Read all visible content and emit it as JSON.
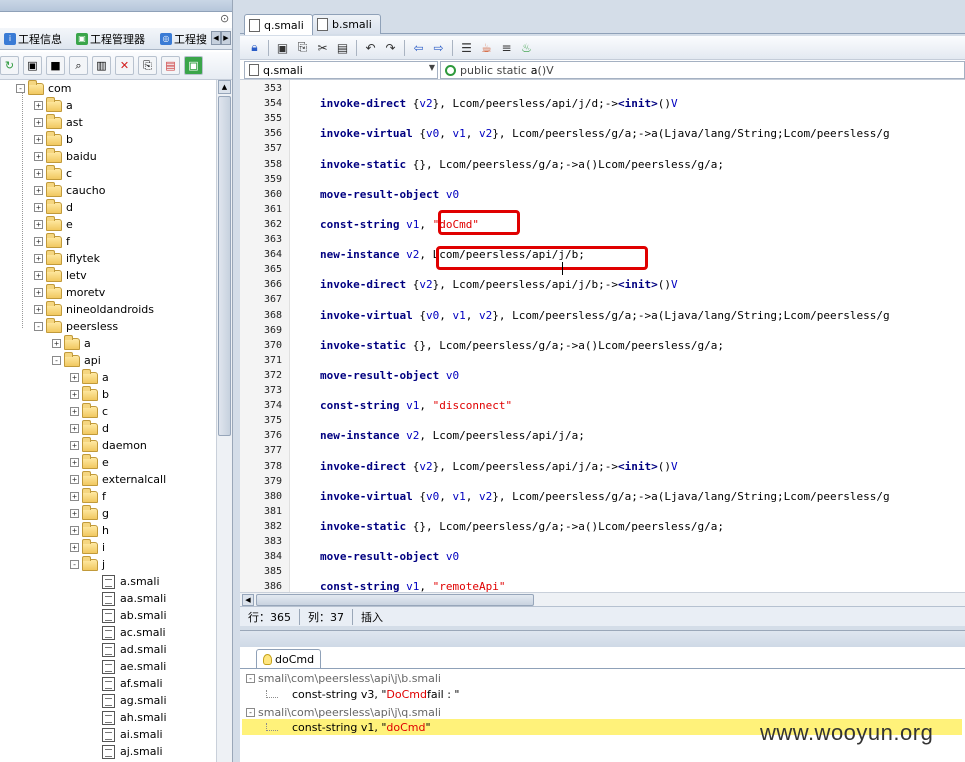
{
  "left_panel": {
    "tabs": [
      {
        "label": "工程信息",
        "icon_color": "#3a7bd5"
      },
      {
        "label": "工程管理器",
        "icon_color": "#3aa54a"
      },
      {
        "label": "工程搜",
        "icon_color": "#3a7bd5"
      }
    ],
    "toolbar_icons": [
      "refresh-icon",
      "screen-icon",
      "stop-icon",
      "find-icon",
      "book-icon",
      "delete-icon",
      "rename-icon",
      "pdf-icon",
      "android-icon"
    ],
    "tree": [
      {
        "label": "com",
        "indent": 0,
        "type": "folder",
        "expander": "-"
      },
      {
        "label": "a",
        "indent": 1,
        "type": "folder",
        "expander": "+"
      },
      {
        "label": "ast",
        "indent": 1,
        "type": "folder",
        "expander": "+"
      },
      {
        "label": "b",
        "indent": 1,
        "type": "folder",
        "expander": "+"
      },
      {
        "label": "baidu",
        "indent": 1,
        "type": "folder",
        "expander": "+"
      },
      {
        "label": "c",
        "indent": 1,
        "type": "folder",
        "expander": "+"
      },
      {
        "label": "caucho",
        "indent": 1,
        "type": "folder",
        "expander": "+"
      },
      {
        "label": "d",
        "indent": 1,
        "type": "folder",
        "expander": "+"
      },
      {
        "label": "e",
        "indent": 1,
        "type": "folder",
        "expander": "+"
      },
      {
        "label": "f",
        "indent": 1,
        "type": "folder",
        "expander": "+"
      },
      {
        "label": "iflytek",
        "indent": 1,
        "type": "folder",
        "expander": "+"
      },
      {
        "label": "letv",
        "indent": 1,
        "type": "folder",
        "expander": "+"
      },
      {
        "label": "moretv",
        "indent": 1,
        "type": "folder",
        "expander": "+"
      },
      {
        "label": "nineoldandroids",
        "indent": 1,
        "type": "folder",
        "expander": "+"
      },
      {
        "label": "peersless",
        "indent": 1,
        "type": "folder",
        "expander": "-"
      },
      {
        "label": "a",
        "indent": 2,
        "type": "folder",
        "expander": "+"
      },
      {
        "label": "api",
        "indent": 2,
        "type": "folder",
        "expander": "-"
      },
      {
        "label": "a",
        "indent": 3,
        "type": "folder",
        "expander": "+"
      },
      {
        "label": "b",
        "indent": 3,
        "type": "folder",
        "expander": "+"
      },
      {
        "label": "c",
        "indent": 3,
        "type": "folder",
        "expander": "+"
      },
      {
        "label": "d",
        "indent": 3,
        "type": "folder",
        "expander": "+"
      },
      {
        "label": "daemon",
        "indent": 3,
        "type": "folder",
        "expander": "+"
      },
      {
        "label": "e",
        "indent": 3,
        "type": "folder",
        "expander": "+"
      },
      {
        "label": "externalcall",
        "indent": 3,
        "type": "folder",
        "expander": "+"
      },
      {
        "label": "f",
        "indent": 3,
        "type": "folder",
        "expander": "+"
      },
      {
        "label": "g",
        "indent": 3,
        "type": "folder",
        "expander": "+"
      },
      {
        "label": "h",
        "indent": 3,
        "type": "folder",
        "expander": "+"
      },
      {
        "label": "i",
        "indent": 3,
        "type": "folder",
        "expander": "+"
      },
      {
        "label": "j",
        "indent": 3,
        "type": "folder",
        "expander": "-"
      },
      {
        "label": "a.smali",
        "indent": 4,
        "type": "file"
      },
      {
        "label": "aa.smali",
        "indent": 4,
        "type": "file"
      },
      {
        "label": "ab.smali",
        "indent": 4,
        "type": "file"
      },
      {
        "label": "ac.smali",
        "indent": 4,
        "type": "file"
      },
      {
        "label": "ad.smali",
        "indent": 4,
        "type": "file"
      },
      {
        "label": "ae.smali",
        "indent": 4,
        "type": "file"
      },
      {
        "label": "af.smali",
        "indent": 4,
        "type": "file"
      },
      {
        "label": "ag.smali",
        "indent": 4,
        "type": "file"
      },
      {
        "label": "ah.smali",
        "indent": 4,
        "type": "file"
      },
      {
        "label": "ai.smali",
        "indent": 4,
        "type": "file"
      },
      {
        "label": "aj.smali",
        "indent": 4,
        "type": "file"
      }
    ]
  },
  "editor": {
    "tabs": [
      {
        "label": "q.smali",
        "active": true
      },
      {
        "label": "b.smali",
        "active": false
      }
    ],
    "file_selector": "q.smali",
    "method_selector": {
      "prefix": "public static",
      "name": "a",
      "suffix": "()V"
    },
    "toolbar_icons": [
      "lock-icon",
      "save-icon",
      "copy-icon",
      "cut-icon",
      "paste-icon",
      "undo-icon",
      "redo-icon",
      "back-icon",
      "forward-icon",
      "format-icon",
      "java-icon",
      "list-icon",
      "decompile-icon"
    ],
    "lines": [
      {
        "no": "353",
        "code": []
      },
      {
        "no": "354",
        "code": [
          [
            "kw",
            "invoke-direct"
          ],
          [
            "t",
            " {"
          ],
          [
            "reg",
            "v2"
          ],
          [
            "t",
            "}, Lcom/peersless/api/j/d;->"
          ],
          [
            "kw",
            "<init>"
          ],
          [
            "t",
            "()"
          ],
          [
            "reg",
            "V"
          ]
        ]
      },
      {
        "no": "355",
        "code": []
      },
      {
        "no": "356",
        "code": [
          [
            "kw",
            "invoke-virtual"
          ],
          [
            "t",
            " {"
          ],
          [
            "reg",
            "v0"
          ],
          [
            "t",
            ", "
          ],
          [
            "reg",
            "v1"
          ],
          [
            "t",
            ", "
          ],
          [
            "reg",
            "v2"
          ],
          [
            "t",
            "}, Lcom/peersless/g/a;->a(Ljava/lang/String;Lcom/peersless/g"
          ]
        ]
      },
      {
        "no": "357",
        "code": []
      },
      {
        "no": "358",
        "code": [
          [
            "kw",
            "invoke-static"
          ],
          [
            "t",
            " {}, Lcom/peersless/g/a;->a()Lcom/peersless/g/a;"
          ]
        ]
      },
      {
        "no": "359",
        "code": []
      },
      {
        "no": "360",
        "code": [
          [
            "kw",
            "move-result-object"
          ],
          [
            "t",
            " "
          ],
          [
            "reg",
            "v0"
          ]
        ]
      },
      {
        "no": "361",
        "code": []
      },
      {
        "no": "362",
        "code": [
          [
            "kw",
            "const-string"
          ],
          [
            "t",
            " "
          ],
          [
            "reg",
            "v1"
          ],
          [
            "t",
            ", "
          ],
          [
            "str",
            "\"doCmd\""
          ]
        ]
      },
      {
        "no": "363",
        "code": []
      },
      {
        "no": "364",
        "code": [
          [
            "kw",
            "new-instance"
          ],
          [
            "t",
            " "
          ],
          [
            "reg",
            "v2"
          ],
          [
            "t",
            ", Lcom/peersless/api/j/b;"
          ]
        ]
      },
      {
        "no": "365",
        "code": []
      },
      {
        "no": "366",
        "code": [
          [
            "kw",
            "invoke-direct"
          ],
          [
            "t",
            " {"
          ],
          [
            "reg",
            "v2"
          ],
          [
            "t",
            "}, Lcom/peersless/api/j/b;->"
          ],
          [
            "kw",
            "<init>"
          ],
          [
            "t",
            "()"
          ],
          [
            "reg",
            "V"
          ]
        ]
      },
      {
        "no": "367",
        "code": []
      },
      {
        "no": "368",
        "code": [
          [
            "kw",
            "invoke-virtual"
          ],
          [
            "t",
            " {"
          ],
          [
            "reg",
            "v0"
          ],
          [
            "t",
            ", "
          ],
          [
            "reg",
            "v1"
          ],
          [
            "t",
            ", "
          ],
          [
            "reg",
            "v2"
          ],
          [
            "t",
            "}, Lcom/peersless/g/a;->a(Ljava/lang/String;Lcom/peersless/g"
          ]
        ]
      },
      {
        "no": "369",
        "code": []
      },
      {
        "no": "370",
        "code": [
          [
            "kw",
            "invoke-static"
          ],
          [
            "t",
            " {}, Lcom/peersless/g/a;->a()Lcom/peersless/g/a;"
          ]
        ]
      },
      {
        "no": "371",
        "code": []
      },
      {
        "no": "372",
        "code": [
          [
            "kw",
            "move-result-object"
          ],
          [
            "t",
            " "
          ],
          [
            "reg",
            "v0"
          ]
        ]
      },
      {
        "no": "373",
        "code": []
      },
      {
        "no": "374",
        "code": [
          [
            "kw",
            "const-string"
          ],
          [
            "t",
            " "
          ],
          [
            "reg",
            "v1"
          ],
          [
            "t",
            ", "
          ],
          [
            "str",
            "\"disconnect\""
          ]
        ]
      },
      {
        "no": "375",
        "code": []
      },
      {
        "no": "376",
        "code": [
          [
            "kw",
            "new-instance"
          ],
          [
            "t",
            " "
          ],
          [
            "reg",
            "v2"
          ],
          [
            "t",
            ", Lcom/peersless/api/j/a;"
          ]
        ]
      },
      {
        "no": "377",
        "code": []
      },
      {
        "no": "378",
        "code": [
          [
            "kw",
            "invoke-direct"
          ],
          [
            "t",
            " {"
          ],
          [
            "reg",
            "v2"
          ],
          [
            "t",
            "}, Lcom/peersless/api/j/a;->"
          ],
          [
            "kw",
            "<init>"
          ],
          [
            "t",
            "()"
          ],
          [
            "reg",
            "V"
          ]
        ]
      },
      {
        "no": "379",
        "code": []
      },
      {
        "no": "380",
        "code": [
          [
            "kw",
            "invoke-virtual"
          ],
          [
            "t",
            " {"
          ],
          [
            "reg",
            "v0"
          ],
          [
            "t",
            ", "
          ],
          [
            "reg",
            "v1"
          ],
          [
            "t",
            ", "
          ],
          [
            "reg",
            "v2"
          ],
          [
            "t",
            "}, Lcom/peersless/g/a;->a(Ljava/lang/String;Lcom/peersless/g"
          ]
        ]
      },
      {
        "no": "381",
        "code": []
      },
      {
        "no": "382",
        "code": [
          [
            "kw",
            "invoke-static"
          ],
          [
            "t",
            " {}, Lcom/peersless/g/a;->a()Lcom/peersless/g/a;"
          ]
        ]
      },
      {
        "no": "383",
        "code": []
      },
      {
        "no": "384",
        "code": [
          [
            "kw",
            "move-result-object"
          ],
          [
            "t",
            " "
          ],
          [
            "reg",
            "v0"
          ]
        ]
      },
      {
        "no": "385",
        "code": []
      },
      {
        "no": "386",
        "code": [
          [
            "kw",
            "const-string"
          ],
          [
            "t",
            " "
          ],
          [
            "reg",
            "v1"
          ],
          [
            "t",
            ", "
          ],
          [
            "str",
            "\"remoteApi\""
          ]
        ]
      }
    ]
  },
  "status_bar": {
    "row_label": "行：365",
    "col_label": "列：37",
    "mode_label": "插入"
  },
  "search_panel": {
    "tab_label": "doCmd",
    "results": [
      {
        "path": "smali\\com\\peersless\\api\\j\\b.smali",
        "match_prefix": "const-string v3, \"",
        "match_hit": "DoCmd",
        "match_suffix": " fail : \"",
        "highlight": false
      },
      {
        "path": "smali\\com\\peersless\\api\\j\\q.smali",
        "match_prefix": "const-string v1, \"",
        "match_hit": "doCmd",
        "match_suffix": "\"",
        "highlight": true
      }
    ]
  },
  "watermark": "www.wooyun.org",
  "colors": {
    "keyword": "#000080",
    "register": "#0000c0",
    "string": "#e00000",
    "highlight_box": "#e00000",
    "search_highlight": "#fff27a"
  }
}
